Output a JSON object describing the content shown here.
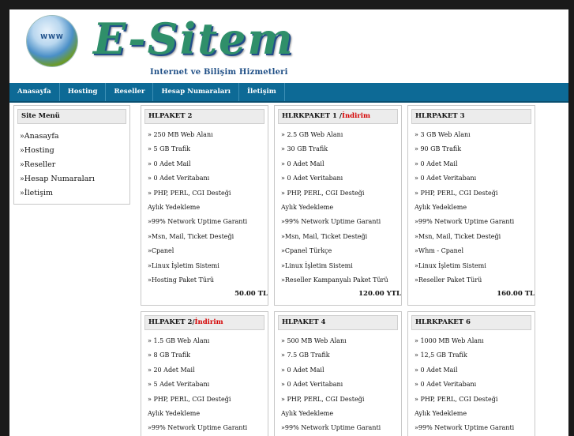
{
  "brand": {
    "logo_text": "E-Sitem",
    "globe_label": "WWW",
    "tagline": "Internet ve Bilişim Hizmetleri"
  },
  "nav": [
    {
      "label": "Anasayfa"
    },
    {
      "label": "Hosting"
    },
    {
      "label": "Reseller"
    },
    {
      "label": "Hesap Numaraları"
    },
    {
      "label": "İletişim"
    }
  ],
  "sidebar": {
    "title": "Site Menü",
    "links": [
      "»Anasayfa",
      "»Hosting",
      "»Reseller",
      "»Hesap Numaraları",
      "»İletişim"
    ]
  },
  "packages": [
    {
      "name": "HLPAKET 2",
      "discount": "",
      "features": [
        "» 250 MB Web Alanı",
        "» 5 GB Trafik",
        "» 0 Adet Mail",
        "» 0 Adet Veritabanı",
        "» PHP, PERL, CGI Desteği",
        "Aylık Yedekleme",
        "»99% Network Uptime Garanti",
        "»Msn, Mail, Ticket Desteği",
        "»Cpanel",
        "»Linux İşletim Sistemi",
        "»Hosting Paket Türü"
      ],
      "price": "50.00 TL"
    },
    {
      "name": "HLRKPAKET 1 /",
      "discount": "İndirim",
      "features": [
        "» 2.5 GB Web Alanı",
        "» 30 GB Trafik",
        "» 0 Adet Mail",
        "» 0 Adet Veritabanı",
        "» PHP, PERL, CGI Desteği",
        "Aylık Yedekleme",
        "»99% Network Uptime Garanti",
        "»Msn, Mail, Ticket Desteği",
        "»Cpanel Türkçe",
        "»Linux İşletim Sistemi",
        "»Reseller Kampanyalı Paket Türü"
      ],
      "price": "120.00 YTL"
    },
    {
      "name": "HLRPAKET 3",
      "discount": "",
      "features": [
        "» 3 GB Web Alanı",
        "» 90 GB Trafik",
        "» 0 Adet Mail",
        "» 0 Adet Veritabanı",
        "» PHP, PERL, CGI Desteği",
        "Aylık Yedekleme",
        "»99% Network Uptime Garanti",
        "»Msn, Mail, Ticket Desteği",
        "»Whm - Cpanel",
        "»Linux İşletim Sistemi",
        "»Reseller Paket Türü"
      ],
      "price": "160.00 TL"
    },
    {
      "name": "HLPAKET 2/",
      "discount": "İndirim",
      "features": [
        "» 1.5 GB Web Alanı",
        "» 8 GB Trafik",
        "» 20 Adet Mail",
        "» 5 Adet Veritabanı",
        "» PHP, PERL, CGI Desteği",
        "Aylık Yedekleme",
        "»99% Network Uptime Garanti"
      ],
      "price": ""
    },
    {
      "name": "HLPAKET 4",
      "discount": "",
      "features": [
        "» 500 MB Web Alanı",
        "» 7.5 GB Trafik",
        "» 0 Adet Mail",
        "» 0 Adet Veritabanı",
        "» PHP, PERL, CGI Desteği",
        "Aylık Yedekleme",
        "»99% Network Uptime Garanti"
      ],
      "price": ""
    },
    {
      "name": "HLRKPAKET 6",
      "discount": "",
      "features": [
        "» 1000 MB Web Alanı",
        "» 12,5 GB Trafik",
        "» 0 Adet Mail",
        "» 0 Adet Veritabanı",
        "» PHP, PERL, CGI Desteği",
        "Aylık Yedekleme",
        "»99% Network Uptime Garanti"
      ],
      "price": ""
    }
  ],
  "colors": {
    "nav_bg": "#0d6a96",
    "discount": "#d40000",
    "logo": "#2f8f6a"
  }
}
